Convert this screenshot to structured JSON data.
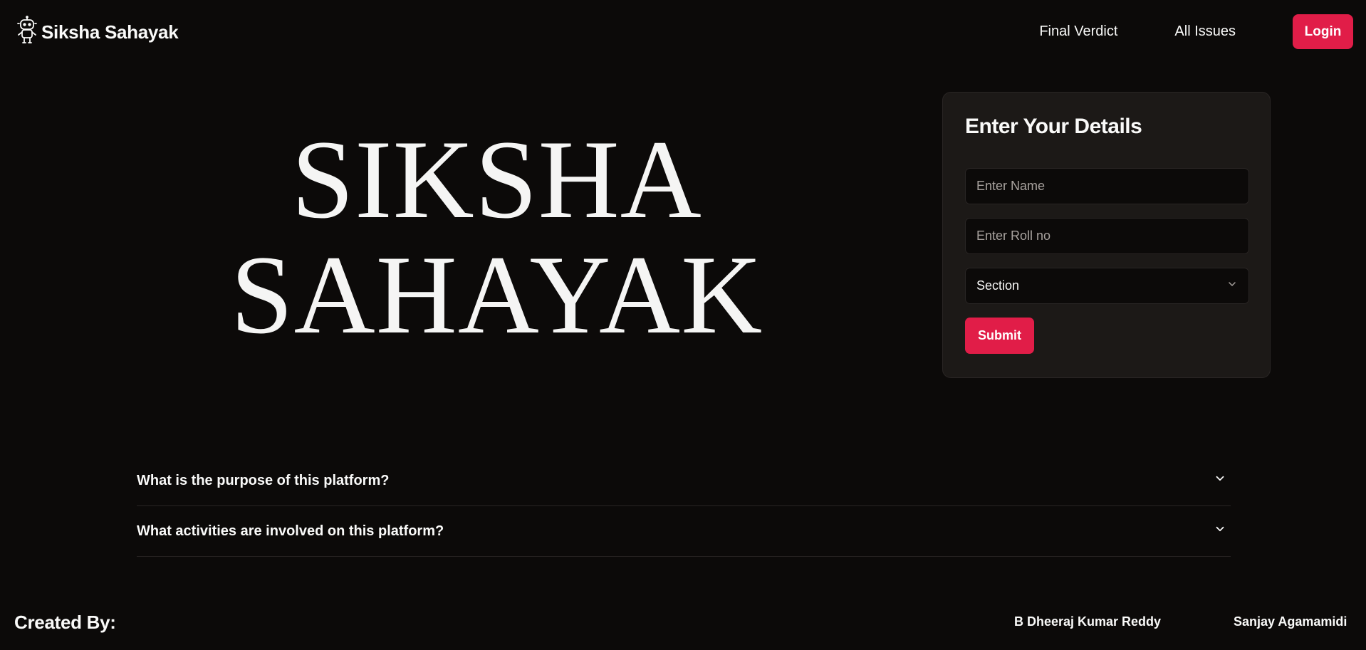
{
  "header": {
    "brand_name": "Siksha Sahayak",
    "brand_icon": "robot-icon",
    "nav": [
      {
        "label": "Final Verdict"
      },
      {
        "label": "All Issues"
      }
    ],
    "login_label": "Login"
  },
  "hero": {
    "line1": "SIKSHA",
    "line2": "SAHAYAK"
  },
  "form": {
    "title": "Enter Your Details",
    "name_placeholder": "Enter Name",
    "roll_placeholder": "Enter Roll no",
    "section_value": "Section",
    "submit_label": "Submit"
  },
  "faq": [
    {
      "question": "What is the purpose of this platform?"
    },
    {
      "question": "What activities are involved on this platform?"
    }
  ],
  "footer": {
    "created_by_label": "Created By:",
    "authors": [
      "B Dheeraj Kumar Reddy",
      "Sanjay Agamamidi"
    ]
  },
  "colors": {
    "background": "#0c0a09",
    "card": "#1c1917",
    "accent": "#e11d48",
    "text": "#fafaf9"
  }
}
